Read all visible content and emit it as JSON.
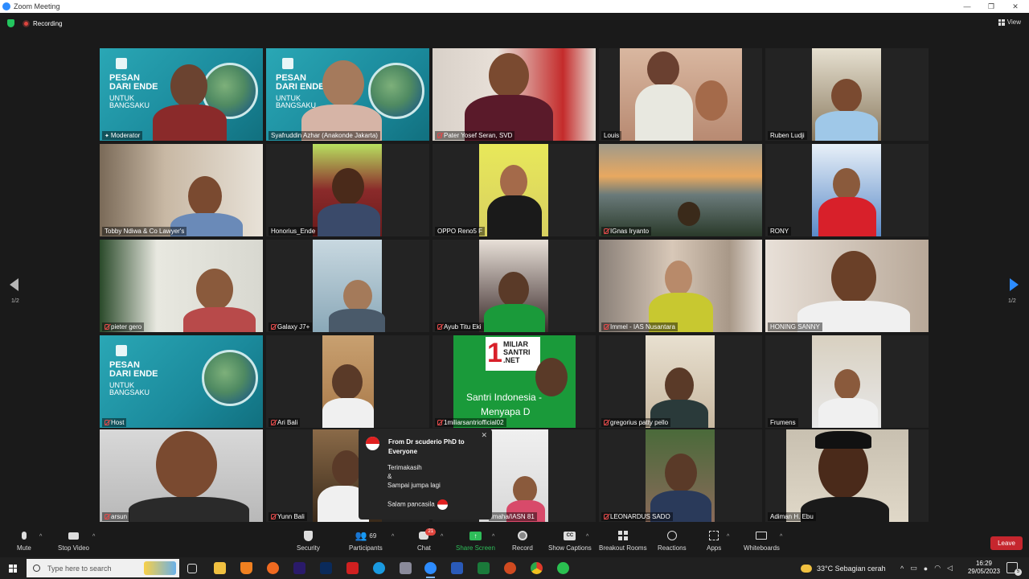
{
  "window": {
    "title": "Zoom Meeting",
    "minimize": "—",
    "restore": "❐",
    "close": "✕"
  },
  "header": {
    "recording": "Recording",
    "view": "View"
  },
  "banner": {
    "line1": "PESAN",
    "line2": "DARI ENDE",
    "line3": "UNTUK",
    "line4": "BANGSAKU"
  },
  "participants": [
    {
      "name": "Moderator"
    },
    {
      "name": "Syafruddin Azhar (Anakonde Jakarta)"
    },
    {
      "name": "Pater Yosef Seran, SVD"
    },
    {
      "name": "Louis"
    },
    {
      "name": "Ruben Ludji"
    },
    {
      "name": "Tobby Ndiwa & Co Lawyer's"
    },
    {
      "name": "Honorius_Ende"
    },
    {
      "name": "OPPO Reno5 F"
    },
    {
      "name": "IGnas Iryanto"
    },
    {
      "name": "RONY"
    },
    {
      "name": "pieter gero"
    },
    {
      "name": "Galaxy J7+"
    },
    {
      "name": "Ayub Titu Eki"
    },
    {
      "name": "Immel - IAS Nusantara"
    },
    {
      "name": "HONING SANNY"
    },
    {
      "name": "Host"
    },
    {
      "name": "Ari Bali"
    },
    {
      "name": "1miliarsantriofficial02"
    },
    {
      "name": "gregorius patty pello"
    },
    {
      "name": "Frumens"
    },
    {
      "name": "arsun"
    },
    {
      "name": "Yunn Bali"
    },
    {
      "name": "imaha/IASN 81"
    },
    {
      "name": "LEONARDUS SADO"
    },
    {
      "name": "Adiman H. Ebu"
    }
  ],
  "santri": {
    "big": "1",
    "top": "MILIAR",
    "mid": "SANTRI",
    "net": ".NET",
    "caption": "Santri Indonesia -",
    "caption2": "Menyapa D"
  },
  "paging": {
    "left": "1/2",
    "right": "1/2"
  },
  "chat_popup": {
    "from": "From Dr scuderio PhD to Everyone",
    "lines": [
      "Terimakasih",
      "&",
      "Sampai jumpa lagi",
      "Salam pancasila"
    ]
  },
  "toolbar": {
    "mute": "Mute",
    "stop_video": "Stop Video",
    "security": "Security",
    "participants": "Participants",
    "participants_count": "69",
    "chat": "Chat",
    "chat_badge": "21",
    "share_screen": "Share Screen",
    "record": "Record",
    "show_captions": "Show Captions",
    "captions_icon": "CC",
    "breakout_rooms": "Breakout Rooms",
    "reactions": "Reactions",
    "apps": "Apps",
    "whiteboards": "Whiteboards",
    "leave": "Leave"
  },
  "taskbar": {
    "search_placeholder": "Type here to search",
    "weather": "33°C  Sebagian cerah",
    "time": "16:29",
    "date": "29/05/2023",
    "notif_count": "5"
  },
  "colors": {
    "zoom_blue": "#2d8cff",
    "share_green": "#2ebd59",
    "leave_red": "#c6262e",
    "active_speaker": "#f3e35c"
  }
}
